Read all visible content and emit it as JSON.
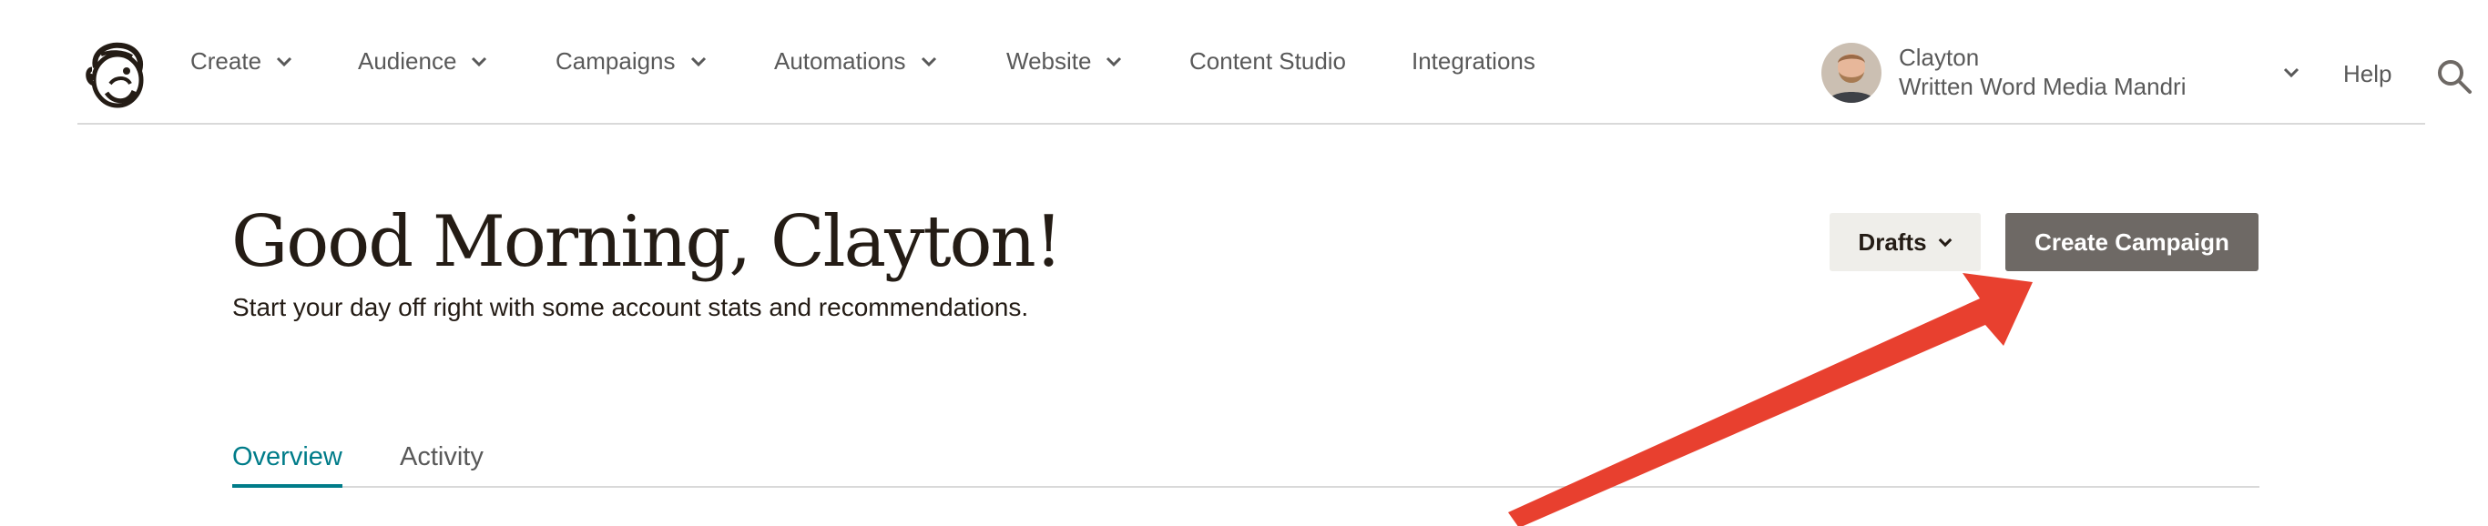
{
  "nav": {
    "items": [
      {
        "label": "Create",
        "dropdown": true
      },
      {
        "label": "Audience",
        "dropdown": true
      },
      {
        "label": "Campaigns",
        "dropdown": true
      },
      {
        "label": "Automations",
        "dropdown": true
      },
      {
        "label": "Website",
        "dropdown": true
      },
      {
        "label": "Content Studio",
        "dropdown": false
      },
      {
        "label": "Integrations",
        "dropdown": false
      }
    ],
    "account": {
      "name": "Clayton",
      "org": "Written Word Media Mandri"
    },
    "help_label": "Help",
    "icons": {
      "logo": "mailchimp-freddie-logo",
      "search": "search-icon",
      "chevron": "chevron-down-icon"
    }
  },
  "header": {
    "greeting": "Good Morning, Clayton!",
    "subtitle": "Start your day off right with some account stats and recommendations.",
    "drafts_label": "Drafts",
    "create_campaign_label": "Create Campaign"
  },
  "tabs": [
    {
      "label": "Overview",
      "active": true
    },
    {
      "label": "Activity",
      "active": false
    }
  ],
  "colors": {
    "primary_button": "#6e6965",
    "secondary_button": "#efeeea",
    "active_tab": "#007c89",
    "annotation_arrow": "#e8402f",
    "text": "#241c15",
    "nav_text": "#595959"
  }
}
